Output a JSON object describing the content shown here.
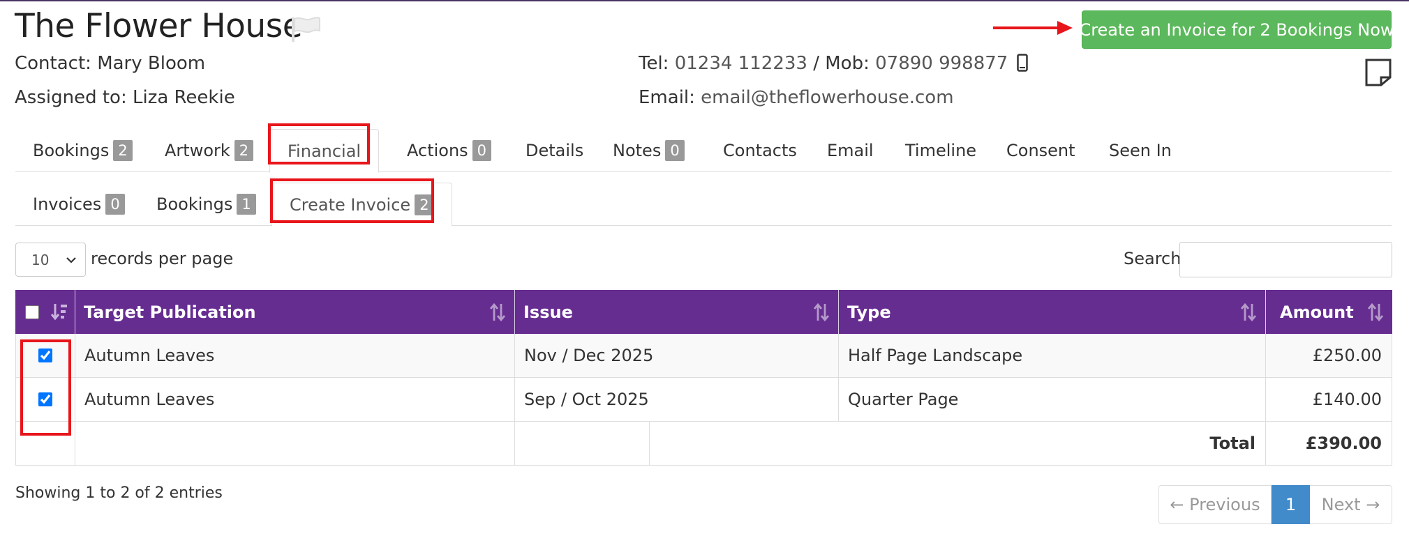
{
  "header": {
    "company_name": "The Flower House",
    "contact_label": "Contact:",
    "contact_name": "Mary Bloom",
    "assigned_label": "Assigned to:",
    "assigned_name": "Liza Reekie",
    "tel_label": "Tel:",
    "tel_value": "01234 112233",
    "separator": "/",
    "mob_label": "Mob:",
    "mob_value": "07890 998877",
    "email_label": "Email:",
    "email_value": "email@theflowerhouse.com",
    "create_invoice_button": "Create an Invoice for 2 Bookings Now",
    "icons": [
      "flag-icon",
      "mobile-phone-icon",
      "sticky-note-icon",
      "arrow-right-icon"
    ]
  },
  "main_tabs": [
    {
      "label": "Bookings",
      "badge": "2"
    },
    {
      "label": "Artwork",
      "badge": "2"
    },
    {
      "label": "Financial",
      "active": true
    },
    {
      "label": "Actions",
      "badge": "0"
    },
    {
      "label": "Details"
    },
    {
      "label": "Notes",
      "badge": "0"
    },
    {
      "label": "Contacts"
    },
    {
      "label": "Email"
    },
    {
      "label": "Timeline"
    },
    {
      "label": "Consent"
    },
    {
      "label": "Seen In"
    }
  ],
  "sub_tabs": [
    {
      "label": "Invoices",
      "badge": "0"
    },
    {
      "label": "Bookings",
      "badge": "1"
    },
    {
      "label": "Create Invoice",
      "badge": "2",
      "active": true
    }
  ],
  "table_controls": {
    "records_per_page_value": "10",
    "records_per_page_label": "records per page",
    "search_label": "Search:",
    "search_value": ""
  },
  "table": {
    "columns": [
      "Target Publication",
      "Issue",
      "Type",
      "Amount"
    ],
    "rows": [
      {
        "checked": true,
        "publication": "Autumn Leaves",
        "issue": "Nov / Dec 2025",
        "type": "Half Page Landscape",
        "amount": "£250.00"
      },
      {
        "checked": true,
        "publication": "Autumn Leaves",
        "issue": "Sep / Oct 2025",
        "type": "Quarter Page",
        "amount": "£140.00"
      }
    ],
    "total_label": "Total",
    "total_value": "£390.00"
  },
  "footer": {
    "entries_info": "Showing 1 to 2 of 2 entries",
    "prev_label": "← Previous",
    "current_page": "1",
    "next_label": "Next →"
  },
  "colors": {
    "table_header": "#662d91",
    "primary_button": "#5cb85c",
    "active_page": "#428bca",
    "annotation_red": "#e8161b",
    "badge": "#999999"
  }
}
